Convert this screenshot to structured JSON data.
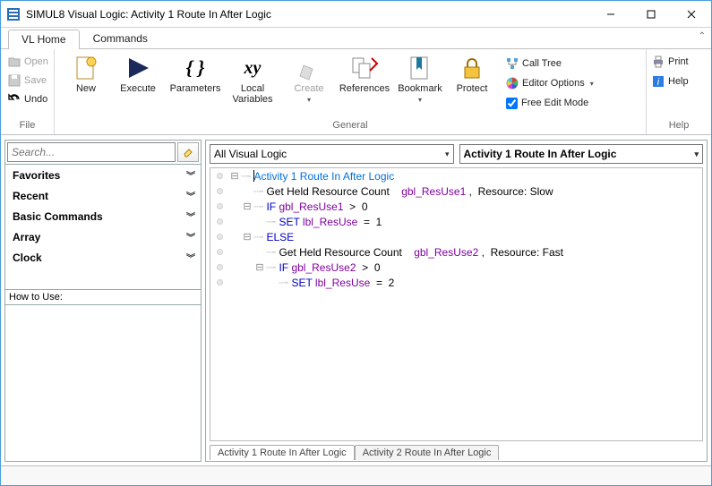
{
  "window": {
    "title": "SIMUL8 Visual Logic: Activity 1 Route In After Logic"
  },
  "tabs": {
    "vl_home": "VL Home",
    "commands": "Commands"
  },
  "ribbon": {
    "file": {
      "open": "Open",
      "save": "Save",
      "undo": "Undo",
      "caption": "File"
    },
    "new": "New",
    "execute": "Execute",
    "parameters": "Parameters",
    "local_vars": "Local\nVariables",
    "create": "Create",
    "references": "References",
    "bookmark": "Bookmark",
    "protect": "Protect",
    "options": {
      "call_tree": "Call Tree",
      "editor_options": "Editor Options",
      "free_edit": "Free Edit Mode"
    },
    "general_caption": "General",
    "help": {
      "print": "Print",
      "help": "Help",
      "caption": "Help"
    }
  },
  "left": {
    "search_placeholder": "Search...",
    "categories": [
      "Favorites",
      "Recent",
      "Basic Commands",
      "Array",
      "Clock"
    ],
    "howto": "How to Use:"
  },
  "combos": {
    "left": "All Visual Logic",
    "right": "Activity 1 Route In After Logic"
  },
  "code": {
    "header": "Activity 1 Route In After Logic",
    "l1a": "Get Held Resource Count    ",
    "l1v": "gbl_ResUse1",
    "l1b": " ,  Resource: Slow",
    "l2k": "IF ",
    "l2v": "gbl_ResUse1",
    "l2b": "  >  0",
    "l3k": "SET ",
    "l3v": "lbl_ResUse",
    "l3b": "  =  1",
    "l4k": "ELSE",
    "l5a": "Get Held Resource Count    ",
    "l5v": "gbl_ResUse2",
    "l5b": " ,  Resource: Fast",
    "l6k": "IF ",
    "l6v": "gbl_ResUse2",
    "l6b": "  >  0",
    "l7k": "SET ",
    "l7v": "lbl_ResUse",
    "l7b": "  =  2"
  },
  "bottom_tabs": [
    "Activity 1 Route In After Logic",
    "Activity 2 Route In After Logic"
  ],
  "glyph": {
    "param_braces": "{ }",
    "xy": "xy",
    "chev_down": "▾",
    "dbl_down": "︾",
    "box_minus": "⊟",
    "dash": "┈╴"
  }
}
